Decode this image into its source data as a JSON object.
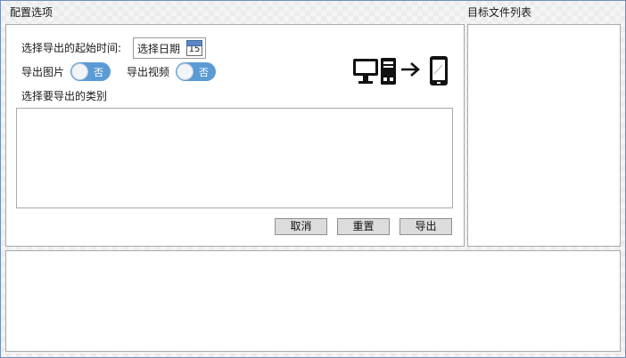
{
  "config": {
    "title": "配置选项",
    "start_time_label": "选择导出的起始时间:",
    "date_picker": {
      "text": "选择日期",
      "calendar_day": "15"
    },
    "export_images": {
      "label": "导出图片",
      "state": "否"
    },
    "export_videos": {
      "label": "导出视频",
      "state": "否"
    },
    "category_label": "选择要导出的类别",
    "category_items": [],
    "buttons": {
      "cancel": "取消",
      "reset": "重置",
      "export": "导出"
    }
  },
  "target_files": {
    "title": "目标文件列表",
    "items": []
  },
  "log": {
    "text": ""
  },
  "colors": {
    "toggle_accent": "#5b9bd5",
    "panel_border": "#a9a9a9",
    "button_face": "#dcdcdc"
  },
  "icons": [
    "desktop-monitor-icon",
    "pc-tower-icon",
    "arrow-right-icon",
    "smartphone-icon",
    "calendar-icon"
  ]
}
